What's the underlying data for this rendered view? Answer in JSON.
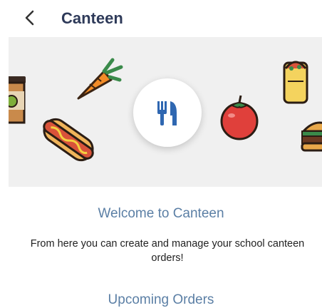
{
  "header": {
    "title": "Canteen",
    "back_icon": "chevron-left-icon"
  },
  "banner": {
    "center_icon": "cutlery-icon",
    "illustrations": [
      "coffee-cup-icon",
      "carrot-icon",
      "hotdog-icon",
      "tomato-icon",
      "burrito-icon",
      "burger-icon"
    ],
    "accent_color": "#2f67b1"
  },
  "welcome": {
    "heading": "Welcome to Canteen",
    "description": "From here you can create and manage your school canteen orders!"
  },
  "orders": {
    "heading": "Upcoming Orders"
  },
  "colors": {
    "title": "#2e3a59",
    "heading": "#5b7fa5",
    "banner_bg": "#f0f0f0"
  }
}
